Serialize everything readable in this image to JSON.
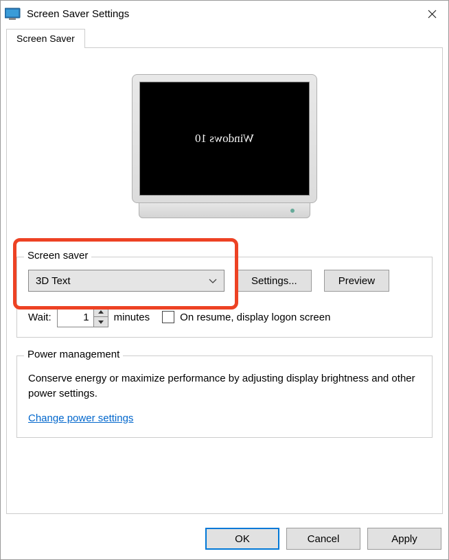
{
  "window": {
    "title": "Screen Saver Settings"
  },
  "tab": {
    "label": "Screen Saver"
  },
  "preview_screen": {
    "text": "Windows 10"
  },
  "screensaver_group": {
    "label": "Screen saver",
    "dropdown_value": "3D Text",
    "settings_button": "Settings...",
    "preview_button": "Preview"
  },
  "wait": {
    "label": "Wait:",
    "value": "1",
    "unit": "minutes",
    "checkbox_label": "On resume, display logon screen"
  },
  "power_group": {
    "label": "Power management",
    "description": "Conserve energy or maximize performance by adjusting display brightness and other power settings.",
    "link": "Change power settings"
  },
  "footer": {
    "ok": "OK",
    "cancel": "Cancel",
    "apply": "Apply"
  }
}
